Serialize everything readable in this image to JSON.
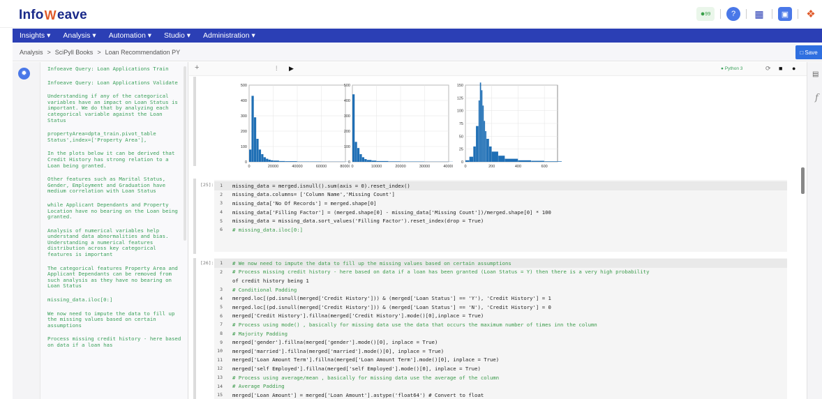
{
  "app": {
    "logo_prefix": "Info",
    "logo_w": "W",
    "logo_suffix": "eave",
    "notif_count": "99"
  },
  "nav": {
    "items": [
      "Insights",
      "Analysis",
      "Automation",
      "Studio",
      "Administration"
    ]
  },
  "breadcrumb": {
    "items": [
      "Analysis",
      "SciPyll Books",
      "Loan Recommendation PY"
    ],
    "separator": ">",
    "save_label": "Save"
  },
  "toolbar": {
    "add": "+",
    "kernel": "Python 3"
  },
  "outline": {
    "items": [
      "Infoeave Query: Loan Applications Train",
      "Infoeave Query: Loan Applications Validate",
      "Understanding if any of the categorical variables have an impact on Loan Status is important. We do that by analyzing each categorical variable against the Loan Status",
      "propertyArea=dpta_train.pivot_table Status',index=['Property Area'],",
      "In the plots below it can be derived that Credit History has strong relation to a Loan being granted.",
      "Other features such as Marital Status, Gender, Employment and Graduation have medium correlation with Loan Status",
      "while Applicant Dependants and Property Location have no bearing on the Loan being granted.",
      "Analysis of numerical variables help understand data abnormalities and bias. Understanding a numerical features distribution across key categorical features is important",
      "The categorical features Property Area and Applicant Dependants can be removed from such analysis as they have no bearing on Loan Status",
      "missing_data.iloc[0:]",
      "We now need to impute the data to fill up the missing values based on certain assumptions",
      "Process missing credit history - here based on data if a loan has"
    ]
  },
  "charts": {
    "hist1": {
      "yticks": [
        "500",
        "400",
        "300",
        "200",
        "100",
        "0"
      ],
      "xticks": [
        "0",
        "20000",
        "40000",
        "60000",
        "80000"
      ]
    },
    "hist2": {
      "yticks": [
        "500",
        "400",
        "300",
        "200",
        "100",
        "0"
      ],
      "xticks": [
        "0",
        "10000",
        "20000",
        "30000",
        "40000"
      ]
    },
    "hist3": {
      "yticks": [
        "150",
        "125",
        "100",
        "75",
        "50",
        "25",
        "0"
      ],
      "xticks": [
        "0",
        "200",
        "400",
        "600"
      ]
    }
  },
  "chart_data": [
    {
      "type": "bar",
      "ylim": [
        0,
        500
      ],
      "xlim": [
        0,
        80000
      ],
      "x": [
        0,
        2000,
        4000,
        6000,
        8000,
        10000,
        12000,
        14000,
        16000,
        18000,
        20000,
        25000,
        30000,
        40000,
        50000,
        60000,
        80000
      ],
      "values": [
        80,
        430,
        290,
        150,
        80,
        50,
        30,
        20,
        14,
        10,
        8,
        5,
        4,
        2,
        2,
        1,
        1
      ]
    },
    {
      "type": "bar",
      "ylim": [
        0,
        500
      ],
      "xlim": [
        0,
        40000
      ],
      "x": [
        0,
        1000,
        2000,
        3000,
        4000,
        5000,
        6000,
        8000,
        10000,
        15000,
        20000,
        30000,
        40000
      ],
      "values": [
        440,
        130,
        90,
        50,
        30,
        18,
        12,
        8,
        5,
        3,
        2,
        1,
        1
      ]
    },
    {
      "type": "bar",
      "ylim": [
        0,
        150
      ],
      "xlim": [
        0,
        700
      ],
      "x": [
        0,
        30,
        60,
        80,
        100,
        110,
        120,
        130,
        140,
        150,
        160,
        180,
        200,
        250,
        300,
        400,
        500,
        600,
        700
      ],
      "values": [
        3,
        10,
        30,
        70,
        120,
        155,
        140,
        110,
        80,
        60,
        45,
        30,
        20,
        12,
        6,
        3,
        2,
        1,
        1
      ]
    }
  ],
  "cells": {
    "c25": {
      "prompt": "[25]:",
      "lines": [
        "missing_data = merged.isnull().sum(axis = 0).reset_index()",
        "missing_data.columns= ['Column Name','Missing Count']",
        "missing_data['No Of Records'] = merged.shape[0]",
        "missing_data['Filling Factor'] = (merged.shape[0] - missing_data['Missing Count'])/merged.shape[0] * 100",
        "missing_data = missing_data.sort_values('Filling Factor').reset_index(drop = True)",
        "# missing_data.iloc[0:]"
      ],
      "nums": [
        "1",
        "2",
        "3",
        "4",
        "5",
        "6"
      ]
    },
    "c26": {
      "prompt": "[26]:",
      "lines": [
        "# We now need to impute the data to fill up the missing values based on certain assumptions",
        "# Process missing credit history - here based on data if a loan has been granted (Loan Status = Y) then there is a very high probability",
        "of credit history being 1",
        "# Conditional Padding",
        "merged.loc[(pd.isnull(merged['Credit History'])) & (merged['Loan Status'] == 'Y'), 'Credit History'] = 1",
        "merged.loc[(pd.isnull(merged['Credit History'])) & (merged['Loan Status'] == 'N'), 'Credit History'] = 0",
        "merged['Credit History'].fillna(merged['Credit History'].mode()[0],inplace = True)",
        "# Process using mode() , basically for missing data use the data that occurs the maximum number of times inn the column",
        "# Majority Padding",
        "merged['gender'].fillna(merged['gender'].mode()[0], inplace = True)",
        "merged['married'].fillna(merged['married'].mode()[0], inplace = True)",
        "merged['Loan Amount Term'].fillna(merged['Loan Amount Term'].mode()[0], inplace = True)",
        "merged['self Employed'].fillna(merged['self Employed'].mode()[0], inplace = True)",
        "# Process using average/mean , basically for missing data use the average of the column",
        "# Average Padding",
        "merged['Loan Amount'] = merged['Loan Amount'].astype('float64') # Convert to float"
      ],
      "nums": [
        "1",
        "2",
        "",
        "3",
        "4",
        "5",
        "6",
        "7",
        "8",
        "9",
        "10",
        "11",
        "12",
        "13",
        "14",
        "15"
      ]
    }
  }
}
